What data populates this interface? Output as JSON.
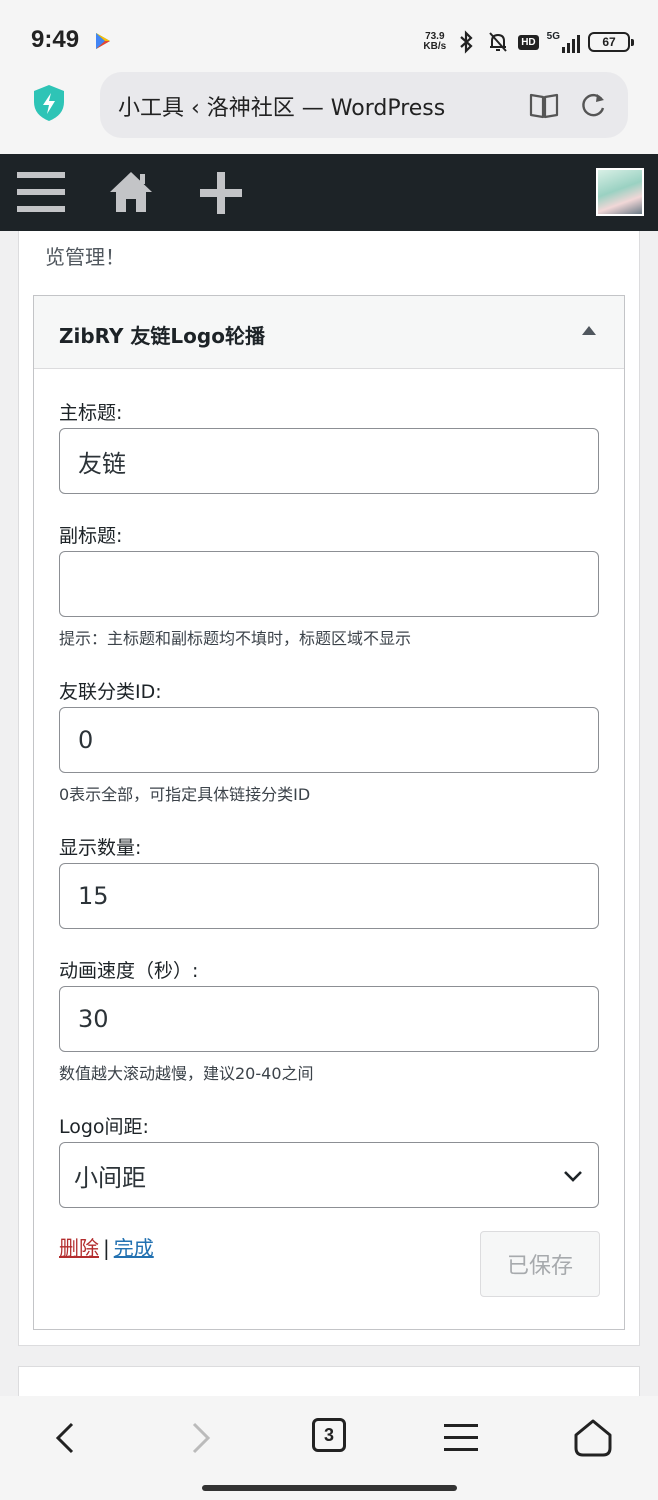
{
  "status_bar": {
    "time": "9:49",
    "net_speed_value": "73.9",
    "net_speed_unit": "KB/s",
    "hd_label": "HD",
    "network": "5G",
    "battery": "67"
  },
  "browser": {
    "url_title": "小工具 ‹ 洛神社区 — WordPress"
  },
  "intro_text": "览管理！",
  "widget": {
    "title": "ZibRY 友链Logo轮播",
    "main_title_label": "主标题:",
    "main_title_value": "友链",
    "subtitle_label": "副标题:",
    "subtitle_value": "",
    "subtitle_hint": "提示：主标题和副标题均不填时，标题区域不显示",
    "category_label": "友联分类ID:",
    "category_value": "0",
    "category_hint": "0表示全部，可指定具体链接分类ID",
    "count_label": "显示数量:",
    "count_value": "15",
    "speed_label": "动画速度（秒）:",
    "speed_value": "30",
    "speed_hint": "数值越大滚动越慢，建议20-40之间",
    "spacing_label": "Logo间距:",
    "spacing_value": "小间距",
    "delete_label": "删除",
    "separator": "|",
    "done_label": "完成",
    "saved_label": "已保存"
  },
  "bottom_nav": {
    "tab_count": "3"
  }
}
